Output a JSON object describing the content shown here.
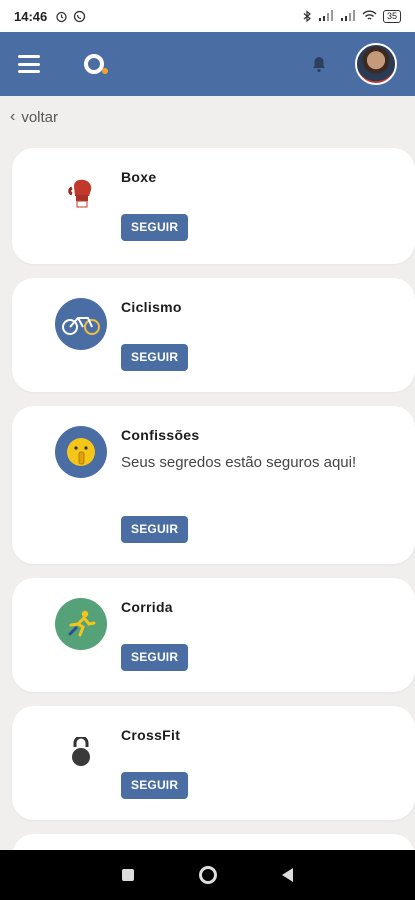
{
  "status_bar": {
    "time": "14:46",
    "battery": "35"
  },
  "header": {
    "menu_icon": "hamburger-menu-icon",
    "logo_icon": "app-logo",
    "bell_icon": "bell-icon",
    "avatar_icon": "user-avatar"
  },
  "nav": {
    "back_label": "voltar"
  },
  "communities": [
    {
      "title": "Boxe",
      "description": "",
      "icon": "boxing-glove-icon",
      "button": "SEGUIR"
    },
    {
      "title": "Ciclismo",
      "description": "",
      "icon": "bicycle-icon",
      "button": "SEGUIR"
    },
    {
      "title": "Confissões",
      "description": "Seus segredos estão seguros aqui!",
      "icon": "shushing-face-icon",
      "button": "SEGUIR"
    },
    {
      "title": "Corrida",
      "description": "",
      "icon": "runner-icon",
      "button": "SEGUIR"
    },
    {
      "title": "CrossFit",
      "description": "",
      "icon": "kettlebell-icon",
      "button": "SEGUIR"
    }
  ],
  "colors": {
    "primary": "#4a6ea4",
    "background": "#f1efed",
    "accent": "#f5a623"
  }
}
